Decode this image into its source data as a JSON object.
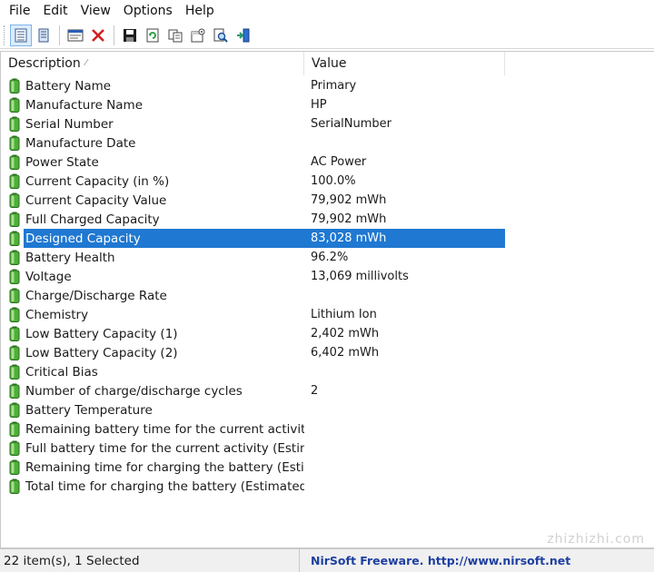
{
  "menu": [
    "File",
    "Edit",
    "View",
    "Options",
    "Help"
  ],
  "toolbar": {
    "icons": [
      "grid-lines-view-icon",
      "report-view-icon",
      "html-report-icon",
      "delete-icon",
      "save-icon",
      "refresh-icon",
      "copy-icon",
      "properties-icon",
      "find-icon",
      "exit-icon"
    ]
  },
  "columns": {
    "description": "Description",
    "value": "Value",
    "sort_indicator": "⁄"
  },
  "rows": [
    {
      "description": "Battery Name",
      "value": "Primary"
    },
    {
      "description": "Manufacture Name",
      "value": "HP"
    },
    {
      "description": "Serial Number",
      "value": "SerialNumber"
    },
    {
      "description": "Manufacture Date",
      "value": ""
    },
    {
      "description": "Power State",
      "value": "AC Power"
    },
    {
      "description": "Current Capacity (in %)",
      "value": "100.0%"
    },
    {
      "description": "Current Capacity Value",
      "value": "79,902 mWh"
    },
    {
      "description": "Full Charged Capacity",
      "value": "79,902 mWh"
    },
    {
      "description": "Designed Capacity",
      "value": "83,028 mWh",
      "selected": true
    },
    {
      "description": "Battery Health",
      "value": "96.2%"
    },
    {
      "description": "Voltage",
      "value": "13,069 millivolts"
    },
    {
      "description": "Charge/Discharge Rate",
      "value": ""
    },
    {
      "description": "Chemistry",
      "value": "Lithium Ion"
    },
    {
      "description": "Low Battery Capacity (1)",
      "value": "2,402 mWh"
    },
    {
      "description": "Low Battery Capacity (2)",
      "value": "6,402 mWh"
    },
    {
      "description": "Critical Bias",
      "value": ""
    },
    {
      "description": "Number of charge/discharge cycles",
      "value": "2"
    },
    {
      "description": "Battery Temperature",
      "value": ""
    },
    {
      "description": "Remaining battery time for the current activity (...",
      "value": ""
    },
    {
      "description": "Full battery time for the current activity (Estimat...",
      "value": ""
    },
    {
      "description": "Remaining time for charging the battery (Estim...",
      "value": ""
    },
    {
      "description": "Total  time for charging the battery (Estimated)",
      "value": ""
    }
  ],
  "status": {
    "items": "22 item(s), 1 Selected",
    "credit": "NirSoft Freeware.  http://www.nirsoft.net"
  },
  "watermark": "zhizhizhi.com",
  "colors": {
    "selection": "#1f78d1",
    "battery_icon": "#3c9a2e",
    "credit_text": "#1e3fa0"
  }
}
